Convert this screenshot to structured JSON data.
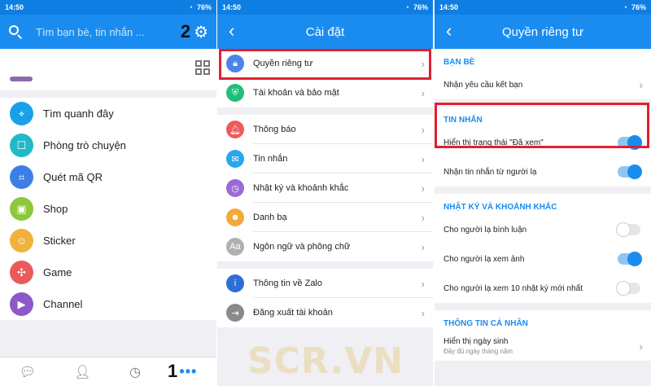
{
  "status_bar": {
    "time": "14:50",
    "battery": "76%"
  },
  "panel1": {
    "search_placeholder": "Tìm bạn bè, tin nhắn ...",
    "step_top": "2",
    "step_bottom": "1",
    "menu": [
      {
        "label": "Tìm quanh đây",
        "icon": "location-pin-icon",
        "color": "#1aa0e6"
      },
      {
        "label": "Phòng trò chuyện",
        "icon": "chat-room-icon",
        "color": "#21b8c9"
      },
      {
        "label": "Quét mã QR",
        "icon": "qr-scan-icon",
        "color": "#3b7fe6"
      },
      {
        "label": "Shop",
        "icon": "shop-bag-icon",
        "color": "#8bc83c"
      },
      {
        "label": "Sticker",
        "icon": "sticker-icon",
        "color": "#f0b23a"
      },
      {
        "label": "Game",
        "icon": "game-icon",
        "color": "#ea5a5a"
      },
      {
        "label": "Channel",
        "icon": "channel-icon",
        "color": "#8e58c8"
      }
    ],
    "nav_more": "•••"
  },
  "panel2": {
    "title": "Cài đặt",
    "groups": [
      [
        {
          "label": "Quyền riêng tư",
          "icon": "lock-icon",
          "color": "#4a86e8"
        },
        {
          "label": "Tài khoản và bảo mật",
          "icon": "shield-icon",
          "color": "#1fbf7a"
        }
      ],
      [
        {
          "label": "Thông báo",
          "icon": "bell-icon",
          "color": "#ef5b5b"
        },
        {
          "label": "Tin nhắn",
          "icon": "message-icon",
          "color": "#2aa6ec"
        },
        {
          "label": "Nhật ký và khoảnh khắc",
          "icon": "clock-icon",
          "color": "#9b6ad6"
        },
        {
          "label": "Danh bạ",
          "icon": "contacts-icon",
          "color": "#f2a93b"
        },
        {
          "label": "Ngôn ngữ và phông chữ",
          "icon": "font-icon",
          "color": "#b0b0b0"
        }
      ],
      [
        {
          "label": "Thông tin về Zalo",
          "icon": "info-icon",
          "color": "#2d6fd6"
        },
        {
          "label": "Đăng xuất tài khoản",
          "icon": "logout-icon",
          "color": "#8a8a8a"
        }
      ]
    ]
  },
  "panel3": {
    "title": "Quyền riêng tư",
    "sections": [
      {
        "heading": "BẠN BÈ",
        "items": [
          {
            "label": "Nhận yêu cầu kết bạn",
            "control": "chevron"
          }
        ]
      },
      {
        "heading": "TIN NHẮN",
        "items": [
          {
            "label": "Hiển thị trạng thái \"Đã xem\"",
            "control": "toggle",
            "on": true
          },
          {
            "label": "Nhận tin nhắn từ người lạ",
            "control": "toggle",
            "on": true
          }
        ]
      },
      {
        "heading": "NHẬT KÝ VÀ KHOẢNH KHẮC",
        "items": [
          {
            "label": "Cho người lạ bình luận",
            "control": "toggle",
            "on": false
          },
          {
            "label": "Cho người lạ xem ảnh",
            "control": "toggle",
            "on": true
          },
          {
            "label": "Cho người lạ xem 10 nhật ký mới nhất",
            "control": "toggle",
            "on": false
          }
        ]
      },
      {
        "heading": "THÔNG TIN CÁ NHÂN",
        "items": [
          {
            "label": "Hiển thị ngày sinh",
            "sub": "Đầy đủ ngày tháng năm",
            "control": "chevron"
          }
        ]
      }
    ]
  },
  "watermark": "SCR.VN",
  "colors": {
    "accent": "#1a8cf0",
    "highlight": "#e0202f"
  }
}
